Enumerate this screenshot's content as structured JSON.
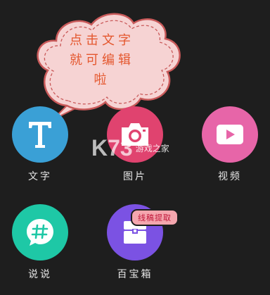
{
  "tooltip": {
    "lines": [
      "点击文字",
      "就可编辑",
      "啦"
    ]
  },
  "items": [
    {
      "label": "文字",
      "icon": "letter-t-icon",
      "color": "#3aa0d6"
    },
    {
      "label": "图片",
      "icon": "camera-icon",
      "color": "#e0436f"
    },
    {
      "label": "视频",
      "icon": "play-video-icon",
      "color": "#e765a8"
    },
    {
      "label": "说说",
      "icon": "hashtag-chat-icon",
      "color": "#1ec8a6"
    },
    {
      "label": "百宝箱",
      "icon": "treasure-box-icon",
      "color": "#7b52e3"
    }
  ],
  "badge": {
    "label": "线稿提取"
  },
  "watermark": {
    "brand": "K73",
    "sub": "游戏之家"
  }
}
